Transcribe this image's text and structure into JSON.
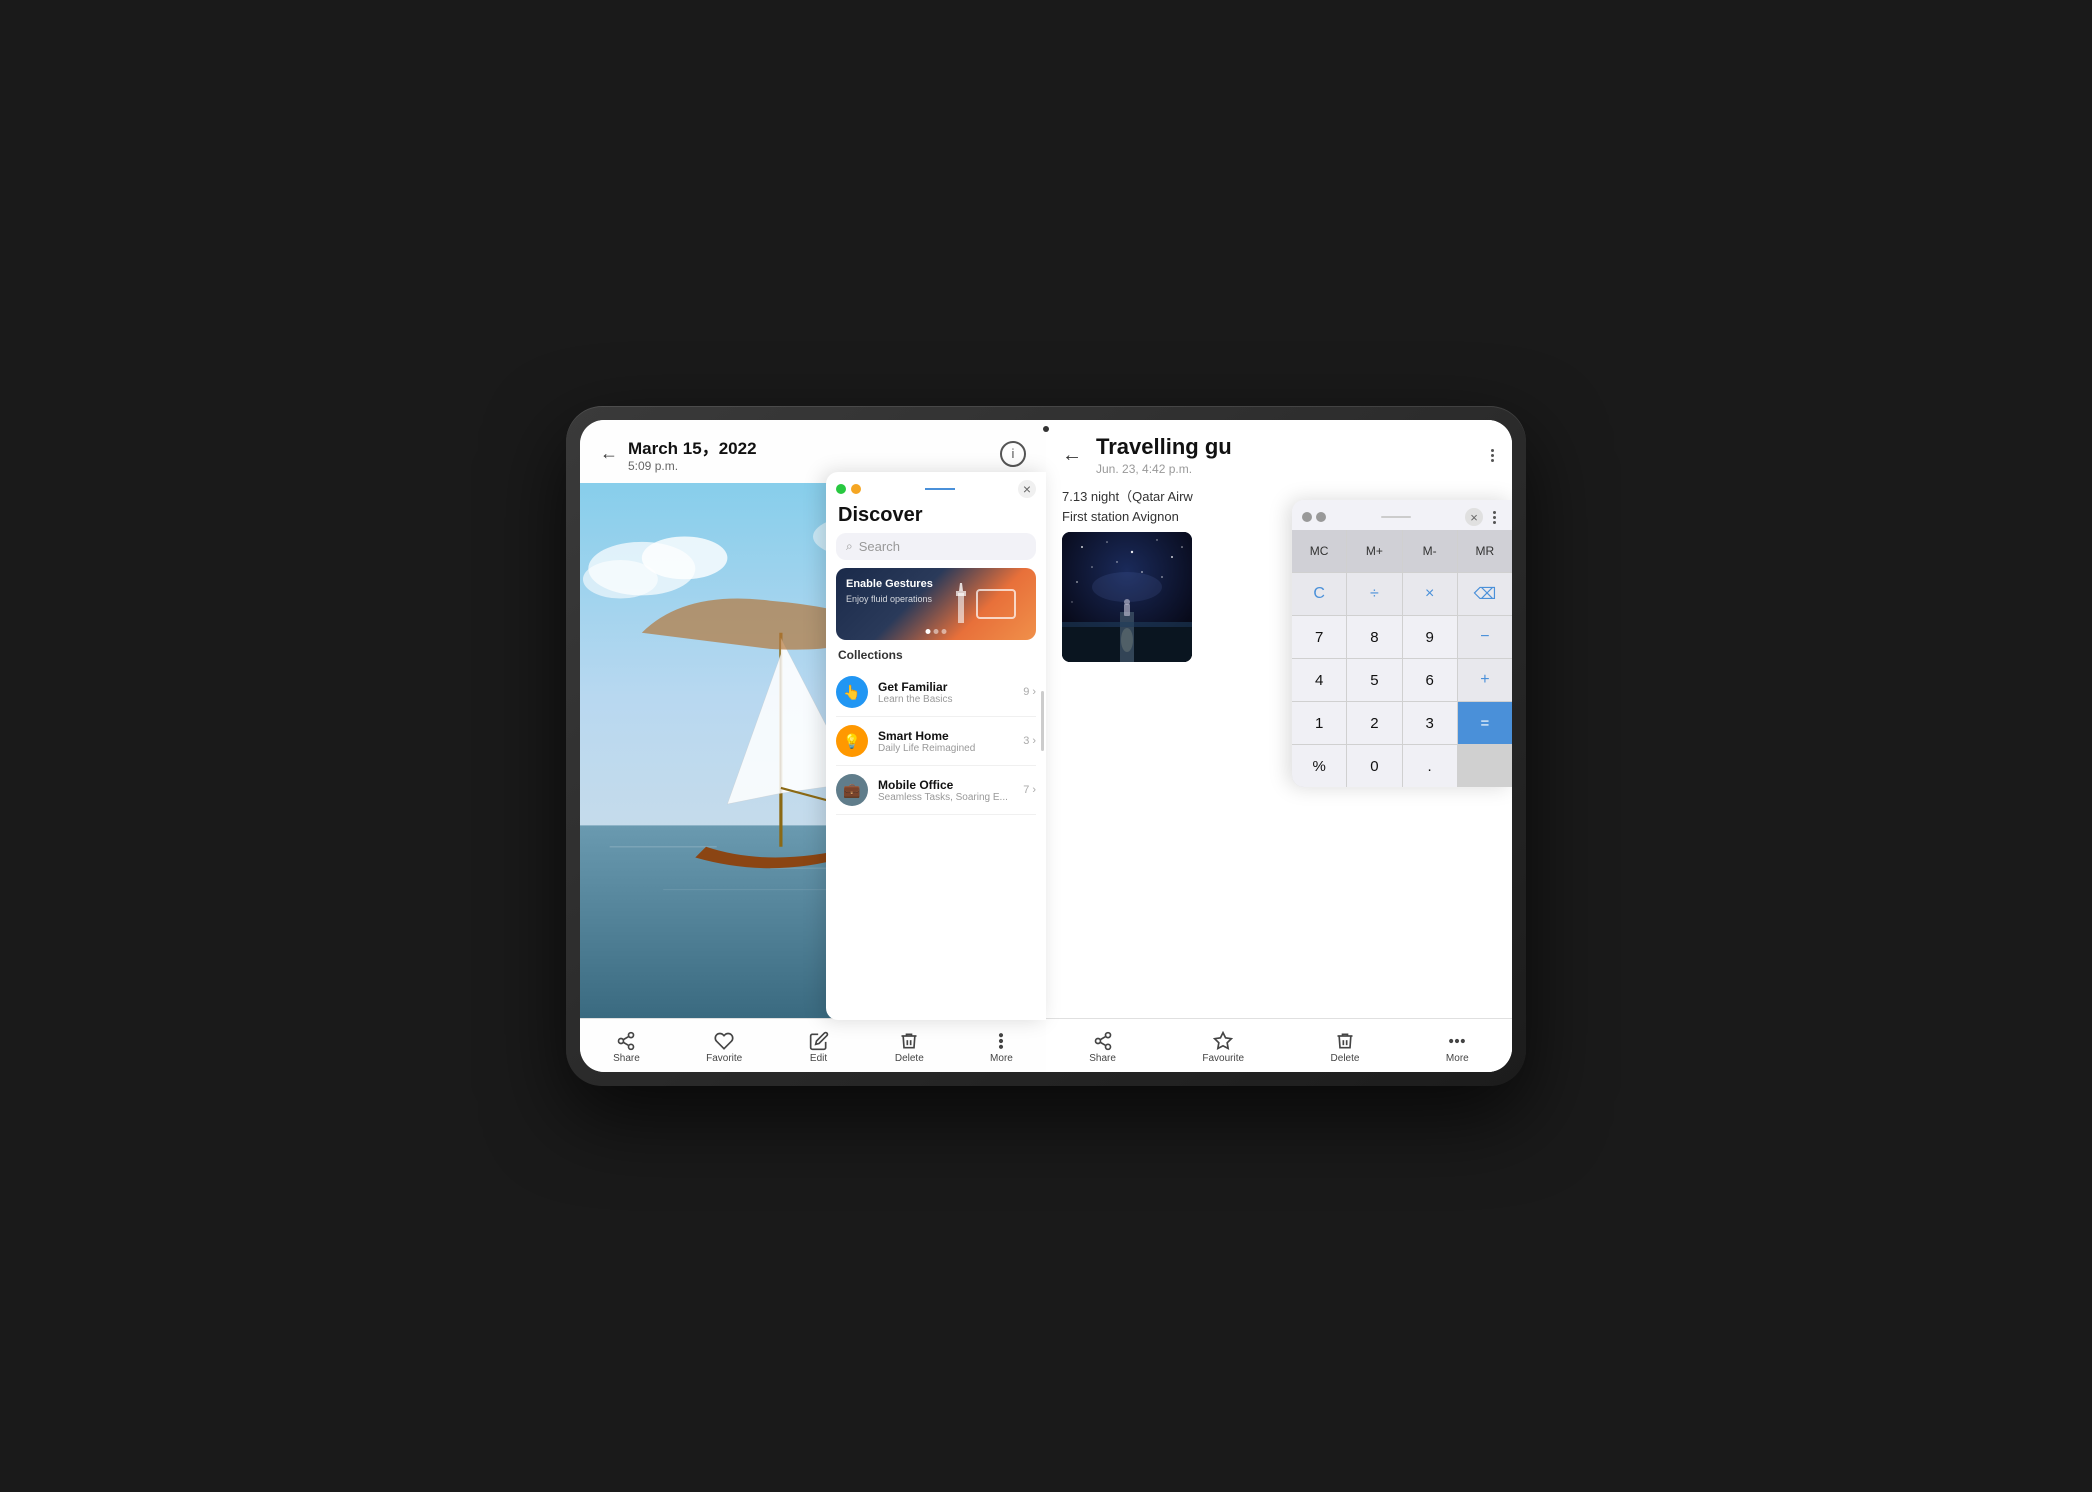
{
  "tablet": {
    "camera": "front-camera"
  },
  "left_header": {
    "back_label": "←",
    "date": "March 15，2022",
    "time": "5:09 p.m.",
    "info_label": "ℹ"
  },
  "discover": {
    "title": "Discover",
    "search_placeholder": "Search",
    "banner": {
      "title": "Enable Gestures",
      "subtitle": "Enjoy fluid operations"
    },
    "collections_title": "Collections",
    "items": [
      {
        "name": "Get Familiar",
        "sub": "Learn the Basics",
        "count": "9",
        "icon_color": "#2196F3",
        "icon": "👆"
      },
      {
        "name": "Smart Home",
        "sub": "Daily Life Reimagined",
        "count": "3",
        "icon_color": "#FF9800",
        "icon": "💡"
      },
      {
        "name": "Mobile Office",
        "sub": "Seamless Tasks, Soaring E...",
        "count": "7",
        "icon_color": "#607D8B",
        "icon": "💼"
      }
    ]
  },
  "left_bar": {
    "items": [
      {
        "label": "Share",
        "icon": "share"
      },
      {
        "label": "Favorite",
        "icon": "heart"
      },
      {
        "label": "Edit",
        "icon": "edit"
      },
      {
        "label": "Delete",
        "icon": "trash"
      },
      {
        "label": "More",
        "icon": "more"
      }
    ]
  },
  "notes": {
    "title": "Travelling gu",
    "date": "Jun. 23, 4:42 p.m.",
    "line1": "7.13 night（Qatar Airw",
    "line2": "First station  Avignon"
  },
  "calculator": {
    "memory_buttons": [
      "MC",
      "M+",
      "M-",
      "MR"
    ],
    "rows": [
      [
        "C",
        "÷",
        "×",
        "⌫"
      ],
      [
        "7",
        "8",
        "9",
        "—"
      ],
      [
        "4",
        "5",
        "6",
        "+"
      ],
      [
        "1",
        "2",
        "3",
        "="
      ],
      [
        "%",
        "0",
        ".",
        "="
      ]
    ]
  },
  "right_bar": {
    "items": [
      {
        "label": "Share",
        "icon": "share"
      },
      {
        "label": "Favourite",
        "icon": "star"
      },
      {
        "label": "Delete",
        "icon": "trash"
      },
      {
        "label": "More",
        "icon": "more"
      }
    ]
  }
}
